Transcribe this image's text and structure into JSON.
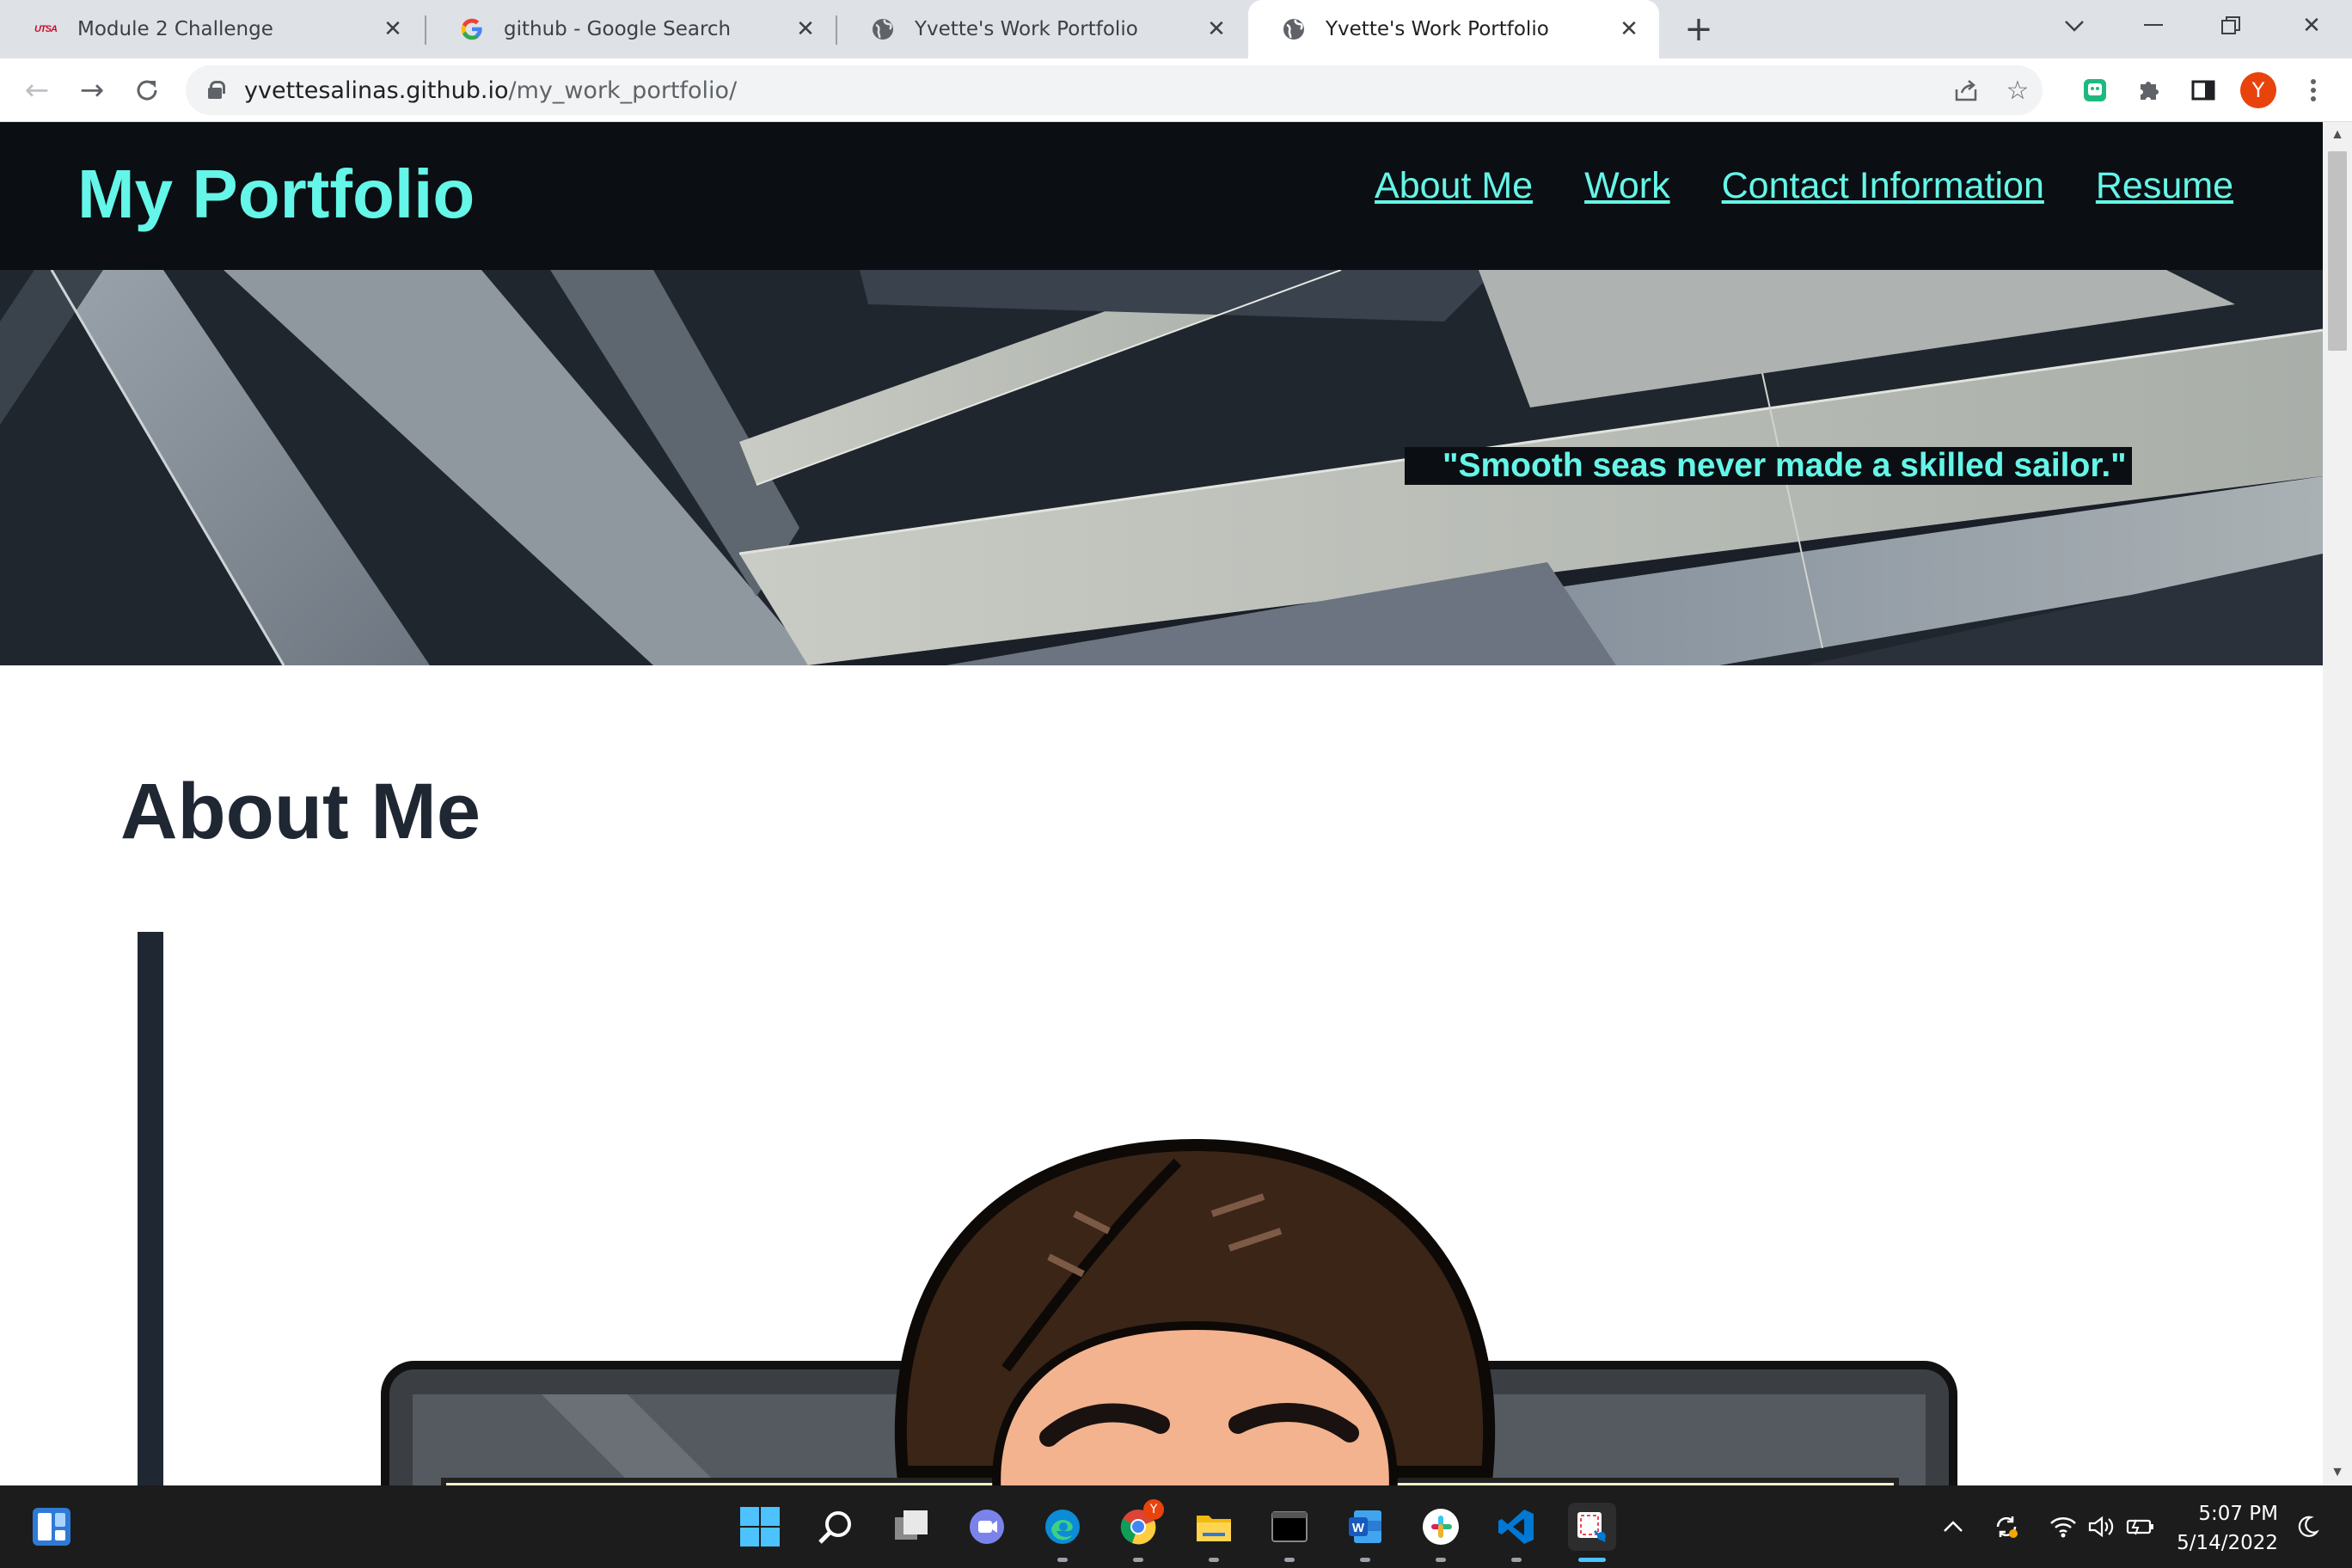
{
  "tabs": [
    {
      "title": "Module 2 Challenge",
      "favicon": "utsa-icon",
      "favicon_text": "UTSA",
      "active": false
    },
    {
      "title": "github - Google Search",
      "favicon": "google-icon",
      "active": false
    },
    {
      "title": "Yvette's Work Portfolio",
      "favicon": "globe-icon",
      "active": false
    },
    {
      "title": "Yvette's Work Portfolio",
      "favicon": "globe-icon",
      "active": true
    }
  ],
  "address_bar": {
    "host": "yvettesalinas.github.io",
    "path": "/my_work_portfolio/"
  },
  "profile_initial": "Y",
  "site": {
    "title": "My Portfolio",
    "nav": [
      "About Me",
      "Work",
      "Contact Information",
      "Resume"
    ],
    "quote": "\"Smooth seas never made a skilled sailor.\"",
    "about_heading": "About Me"
  },
  "colors": {
    "accent": "#64f6e8",
    "header_bg": "#0b0e12",
    "heading_text": "#1f2733"
  },
  "taskbar": {
    "icons": [
      "widgets-icon",
      "windows-start-icon",
      "search-icon",
      "task-view-icon",
      "teams-chat-icon",
      "edge-icon",
      "chrome-icon",
      "file-explorer-icon",
      "terminal-icon",
      "word-icon",
      "slack-icon",
      "vscode-icon",
      "snipping-tool-icon"
    ],
    "chrome_badge": "Y",
    "time": "5:07 PM",
    "date": "5/14/2022"
  }
}
